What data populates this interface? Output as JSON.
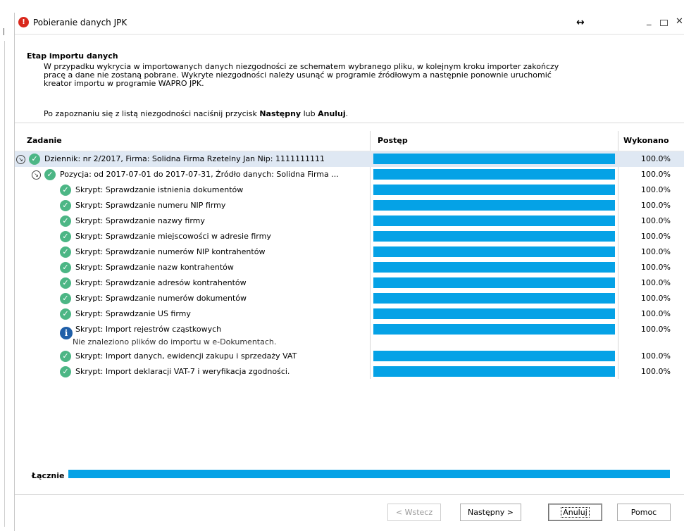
{
  "window": {
    "title": "Pobieranie danych JPK",
    "resize_glyph": "↔",
    "minimize_glyph": "_",
    "close_glyph": "✕"
  },
  "header": {
    "stage_title": "Etap importu danych",
    "description": "W przypadku wykrycia w importowanych danych niezgodności ze schematem wybranego pliku, w kolejnym kroku importer zakończy\npracę a dane nie zostaną pobrane. Wykryte niezgodności należy usunąć w programie źródłowym a następnie ponownie uruchomić\nkreator importu w programie WAPRO JPK.",
    "hint_prefix": "Po zapoznaniu się z listą niezgodności naciśnij przycisk ",
    "hint_next": "Następny",
    "hint_mid": " lub ",
    "hint_cancel": "Anuluj",
    "hint_suffix": "."
  },
  "grid": {
    "columns": {
      "task": "Zadanie",
      "progress": "Postęp",
      "done": "Wykonano"
    },
    "rows": [
      {
        "label": "Dziennik: nr 2/2017, Firma: Solidna Firma Rzetelny Jan Nip: 1111111111",
        "percent": "100.0%",
        "progress": 1.0,
        "status": "ok",
        "level": 0,
        "expandable": true,
        "selected": true
      },
      {
        "label": "Pozycja: od 2017-07-01 do 2017-07-31, Źródło danych: Solidna Firma ...",
        "percent": "100.0%",
        "progress": 1.0,
        "status": "ok",
        "level": 1,
        "expandable": true
      },
      {
        "label": "Skrypt: Sprawdzanie istnienia dokumentów",
        "percent": "100.0%",
        "progress": 1.0,
        "status": "ok",
        "level": 2
      },
      {
        "label": "Skrypt: Sprawdzanie numeru NIP firmy",
        "percent": "100.0%",
        "progress": 1.0,
        "status": "ok",
        "level": 2
      },
      {
        "label": "Skrypt: Sprawdzanie nazwy firmy",
        "percent": "100.0%",
        "progress": 1.0,
        "status": "ok",
        "level": 2
      },
      {
        "label": "Skrypt: Sprawdzanie miejscowości w adresie firmy",
        "percent": "100.0%",
        "progress": 1.0,
        "status": "ok",
        "level": 2
      },
      {
        "label": "Skrypt: Sprawdzanie numerów NIP kontrahentów",
        "percent": "100.0%",
        "progress": 1.0,
        "status": "ok",
        "level": 2
      },
      {
        "label": "Skrypt: Sprawdzanie nazw kontrahentów",
        "percent": "100.0%",
        "progress": 1.0,
        "status": "ok",
        "level": 2
      },
      {
        "label": "Skrypt: Sprawdzanie adresów kontrahentów",
        "percent": "100.0%",
        "progress": 1.0,
        "status": "ok",
        "level": 2
      },
      {
        "label": "Skrypt: Sprawdzanie numerów dokumentów",
        "percent": "100.0%",
        "progress": 1.0,
        "status": "ok",
        "level": 2
      },
      {
        "label": "Skrypt: Sprawdzanie US firmy",
        "percent": "100.0%",
        "progress": 1.0,
        "status": "ok",
        "level": 2
      },
      {
        "label": "Skrypt: Import rejestrów cząstkowych",
        "sublabel": "Nie znaleziono plików do importu w e-Dokumentach.",
        "percent": "100.0%",
        "progress": 1.0,
        "status": "info",
        "level": 2
      },
      {
        "label": "Skrypt: Import danych, ewidencji zakupu i sprzedaży VAT",
        "percent": "100.0%",
        "progress": 1.0,
        "status": "ok",
        "level": 2
      },
      {
        "label": "Skrypt: Import deklaracji VAT-7 i weryfikacja zgodności.",
        "percent": "100.0%",
        "progress": 1.0,
        "status": "ok",
        "level": 2
      }
    ]
  },
  "total": {
    "label": "Łącznie",
    "progress": 1.0
  },
  "buttons": {
    "back": "< Wstecz",
    "next": "Następny >",
    "cancel": "Anuluj",
    "help": "Pomoc"
  },
  "colors": {
    "progress_fill": "#05a2e6",
    "ok_icon": "#4cb685",
    "info_icon": "#1f5fa8",
    "selected_row": "#dfe8f3"
  }
}
